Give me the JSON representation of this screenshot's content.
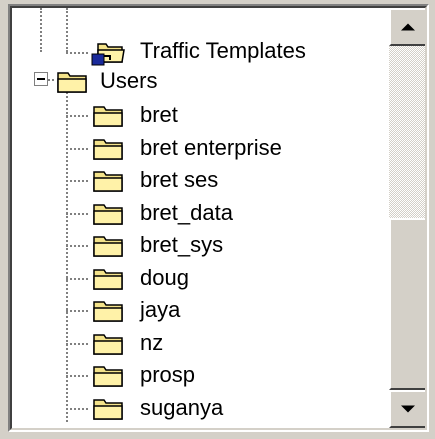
{
  "tree": {
    "partial_top": {
      "label": "Traffic Templates",
      "icon": "shortcut-folder-icon"
    },
    "users": {
      "label": "Users",
      "icon": "folder-icon",
      "expanded": true
    },
    "children": [
      {
        "label": "bret"
      },
      {
        "label": "bret enterprise"
      },
      {
        "label": "bret ses"
      },
      {
        "label": "bret_data"
      },
      {
        "label": "bret_sys"
      },
      {
        "label": "doug"
      },
      {
        "label": "jaya"
      },
      {
        "label": "nz"
      },
      {
        "label": "prosp"
      },
      {
        "label": "suganya"
      }
    ]
  },
  "scrollbar": {
    "up_icon": "arrow-up-icon",
    "down_icon": "arrow-down-icon",
    "position_fraction": 0.55
  },
  "colors": {
    "folder": "#f4e38a",
    "folder_edge": "#000000",
    "window_bg": "#d4d0c8"
  }
}
